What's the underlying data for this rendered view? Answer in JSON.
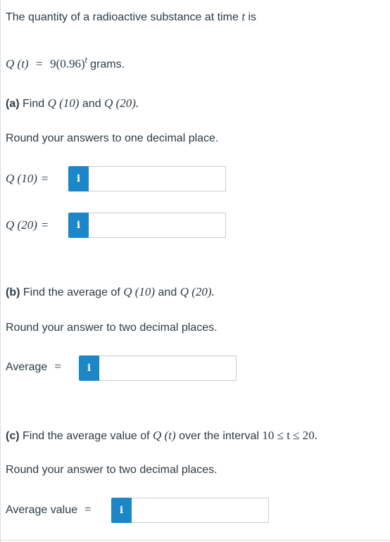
{
  "intro": {
    "text": "The quantity of a radioactive substance at time",
    "var": "t",
    "suffix": "is"
  },
  "formula": {
    "lhs": "Q (t)",
    "eq": "=",
    "rhs_base": "9(0.96)",
    "rhs_exp": "t",
    "unit": "grams."
  },
  "part_a": {
    "label": "(a)",
    "prompt": "Find",
    "q1": "Q (10)",
    "and": "and",
    "q2": "Q (20).",
    "instruction": "Round your answers to one decimal place.",
    "answer1": {
      "label": "Q (10)",
      "eq": "=",
      "info": "i",
      "value": "",
      "placeholder": ""
    },
    "answer2": {
      "label": "Q (20)",
      "eq": "=",
      "info": "i",
      "value": "",
      "placeholder": ""
    }
  },
  "part_b": {
    "label": "(b)",
    "prompt": "Find the average of",
    "q1": "Q (10)",
    "and": "and",
    "q2": "Q (20).",
    "instruction": "Round your answer to two decimal places.",
    "answer": {
      "label": "Average",
      "eq": "=",
      "info": "i",
      "value": "",
      "placeholder": ""
    }
  },
  "part_c": {
    "label": "(c)",
    "prompt": "Find the average value of",
    "q": "Q (t)",
    "middle": "over the interval",
    "interval": "10  ≤ t ≤  20.",
    "instruction": "Round your answer to two decimal places.",
    "answer": {
      "label": "Average value",
      "eq": "=",
      "info": "i",
      "value": "",
      "placeholder": ""
    }
  }
}
